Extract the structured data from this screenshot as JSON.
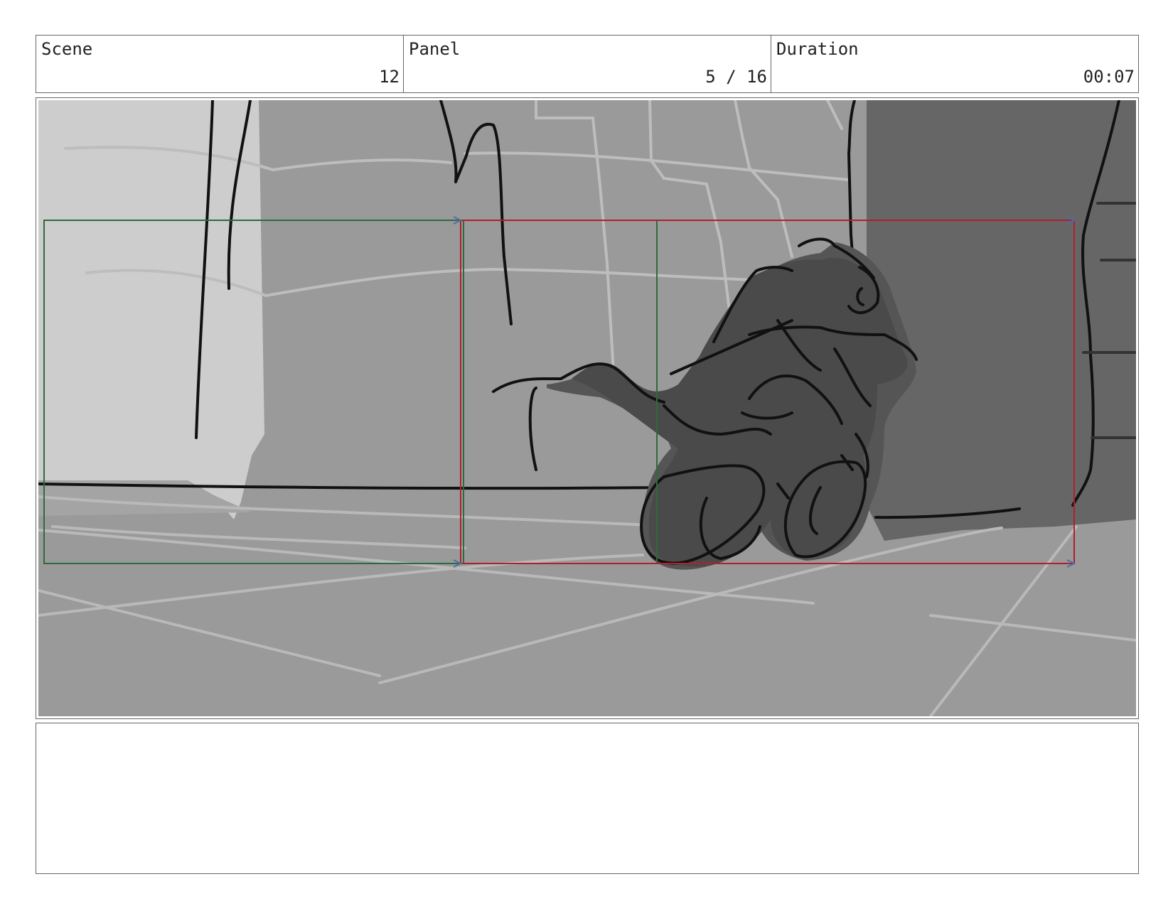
{
  "header": {
    "scene": {
      "label": "Scene",
      "value": "12"
    },
    "panel": {
      "label": "Panel",
      "value": "5 / 16"
    },
    "duration": {
      "label": "Duration",
      "value": "00:07"
    }
  },
  "colors": {
    "camera_start_frame": "#2e6b3a",
    "camera_end_frame": "#b01f2e",
    "arrow": "#4a6fa5"
  },
  "notes": {
    "text": ""
  }
}
